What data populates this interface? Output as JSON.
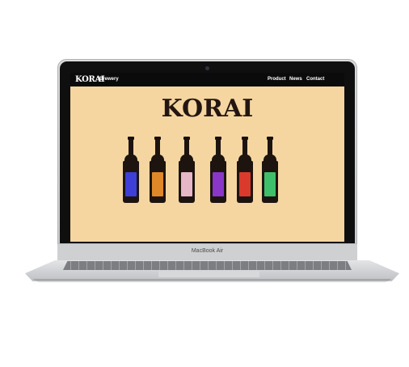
{
  "site": {
    "logo": "KORAI",
    "brand_sub": "Brewery",
    "nav": [
      "Product",
      "News",
      "Contact"
    ],
    "hero_title": "KORAI"
  },
  "device": {
    "model": "MacBook Air"
  },
  "bottles": [
    {
      "name": "blue",
      "label_color": "#3d3fd6"
    },
    {
      "name": "orange",
      "label_color": "#e0872a"
    },
    {
      "name": "pink",
      "label_color": "#e6b7c6"
    },
    {
      "name": "purple",
      "label_color": "#8a36c9"
    },
    {
      "name": "red",
      "label_color": "#d93a2c"
    },
    {
      "name": "green",
      "label_color": "#3fbf6a"
    }
  ],
  "colors": {
    "page_background": "#f5d6a0",
    "nav_background": "#0b0b0b",
    "bottle_glass": "#1d1410"
  }
}
